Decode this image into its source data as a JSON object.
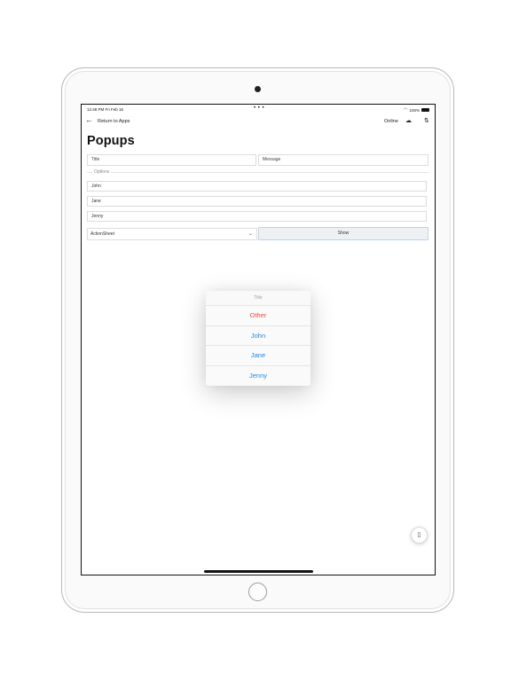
{
  "status_bar": {
    "time": "12:48 PM   Fri Feb 16",
    "dots": "• • •",
    "battery": "100%"
  },
  "nav": {
    "back_label": "Return to Apps",
    "online_label": "Online"
  },
  "page": {
    "title": "Popups"
  },
  "form": {
    "title_placeholder": "Title",
    "message_placeholder": "Message",
    "options_legend": "Options",
    "options": [
      "John",
      "Jane",
      "Jenny"
    ],
    "popup_type": "ActionSheet",
    "show_label": "Show"
  },
  "action_sheet": {
    "title": "Title",
    "buttons": [
      {
        "label": "Other",
        "color": "#e74c3c"
      },
      {
        "label": "John",
        "color": "#1e88e5"
      },
      {
        "label": "Jane",
        "color": "#1e88e5"
      },
      {
        "label": "Jenny",
        "color": "#1e88e5"
      }
    ]
  },
  "icons": {
    "back": "left-arrow",
    "cloud": "cloud",
    "filter": "filter",
    "wifi": "wifi",
    "battery": "battery",
    "chevron": "chevron-down",
    "rotate": "rotate-device"
  }
}
